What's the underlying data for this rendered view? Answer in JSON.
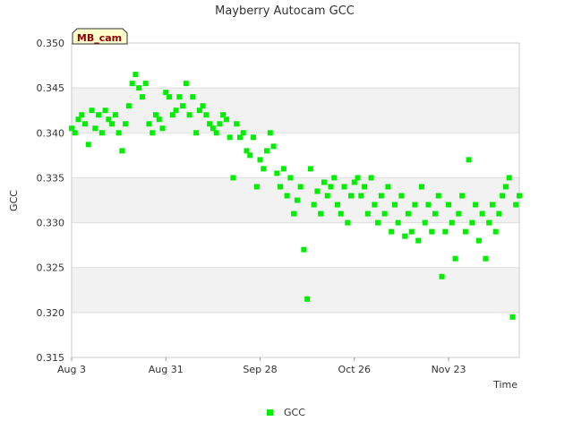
{
  "chart_data": {
    "type": "scatter",
    "title": "Mayberry Autocam GCC",
    "xlabel": "Time",
    "ylabel": "GCC",
    "badge": "MB_cam",
    "xlim": [
      "2024-08-03",
      "2024-12-14"
    ],
    "ylim": [
      0.315,
      0.35
    ],
    "x_ticks": [
      {
        "date": "2024-08-03",
        "label": "Aug 3"
      },
      {
        "date": "2024-08-31",
        "label": "Aug 31"
      },
      {
        "date": "2024-09-28",
        "label": "Sep 28"
      },
      {
        "date": "2024-10-26",
        "label": "Oct 26"
      },
      {
        "date": "2024-11-23",
        "label": "Nov 23"
      }
    ],
    "y_ticks": [
      "0.315",
      "0.320",
      "0.325",
      "0.330",
      "0.335",
      "0.340",
      "0.345",
      "0.350"
    ],
    "grid": true,
    "legend_position": "bottom",
    "marker_color": "#00ee00",
    "series": [
      {
        "name": "GCC",
        "points": [
          [
            "2024-08-03",
            0.3405
          ],
          [
            "2024-08-04",
            0.34
          ],
          [
            "2024-08-05",
            0.3415
          ],
          [
            "2024-08-06",
            0.342
          ],
          [
            "2024-08-07",
            0.341
          ],
          [
            "2024-08-08",
            0.3387
          ],
          [
            "2024-08-09",
            0.3425
          ],
          [
            "2024-08-10",
            0.3405
          ],
          [
            "2024-08-11",
            0.342
          ],
          [
            "2024-08-12",
            0.34
          ],
          [
            "2024-08-13",
            0.3425
          ],
          [
            "2024-08-14",
            0.3415
          ],
          [
            "2024-08-15",
            0.341
          ],
          [
            "2024-08-16",
            0.342
          ],
          [
            "2024-08-17",
            0.34
          ],
          [
            "2024-08-18",
            0.338
          ],
          [
            "2024-08-19",
            0.341
          ],
          [
            "2024-08-20",
            0.343
          ],
          [
            "2024-08-21",
            0.3455
          ],
          [
            "2024-08-22",
            0.3465
          ],
          [
            "2024-08-23",
            0.345
          ],
          [
            "2024-08-24",
            0.344
          ],
          [
            "2024-08-25",
            0.3455
          ],
          [
            "2024-08-26",
            0.341
          ],
          [
            "2024-08-27",
            0.34
          ],
          [
            "2024-08-28",
            0.342
          ],
          [
            "2024-08-29",
            0.3415
          ],
          [
            "2024-08-30",
            0.3405
          ],
          [
            "2024-08-31",
            0.3445
          ],
          [
            "2024-09-01",
            0.344
          ],
          [
            "2024-09-02",
            0.342
          ],
          [
            "2024-09-03",
            0.3425
          ],
          [
            "2024-09-04",
            0.344
          ],
          [
            "2024-09-05",
            0.343
          ],
          [
            "2024-09-06",
            0.3455
          ],
          [
            "2024-09-07",
            0.342
          ],
          [
            "2024-09-08",
            0.344
          ],
          [
            "2024-09-09",
            0.34
          ],
          [
            "2024-09-10",
            0.3425
          ],
          [
            "2024-09-11",
            0.343
          ],
          [
            "2024-09-12",
            0.342
          ],
          [
            "2024-09-13",
            0.341
          ],
          [
            "2024-09-14",
            0.3405
          ],
          [
            "2024-09-15",
            0.34
          ],
          [
            "2024-09-16",
            0.341
          ],
          [
            "2024-09-17",
            0.342
          ],
          [
            "2024-09-18",
            0.3415
          ],
          [
            "2024-09-19",
            0.3395
          ],
          [
            "2024-09-20",
            0.335
          ],
          [
            "2024-09-21",
            0.341
          ],
          [
            "2024-09-22",
            0.3395
          ],
          [
            "2024-09-23",
            0.34
          ],
          [
            "2024-09-24",
            0.338
          ],
          [
            "2024-09-25",
            0.3375
          ],
          [
            "2024-09-26",
            0.3395
          ],
          [
            "2024-09-27",
            0.334
          ],
          [
            "2024-09-28",
            0.337
          ],
          [
            "2024-09-29",
            0.336
          ],
          [
            "2024-09-30",
            0.338
          ],
          [
            "2024-10-01",
            0.34
          ],
          [
            "2024-10-02",
            0.3385
          ],
          [
            "2024-10-03",
            0.3355
          ],
          [
            "2024-10-04",
            0.334
          ],
          [
            "2024-10-05",
            0.336
          ],
          [
            "2024-10-06",
            0.333
          ],
          [
            "2024-10-07",
            0.335
          ],
          [
            "2024-10-08",
            0.331
          ],
          [
            "2024-10-09",
            0.3325
          ],
          [
            "2024-10-10",
            0.334
          ],
          [
            "2024-10-11",
            0.327
          ],
          [
            "2024-10-12",
            0.3215
          ],
          [
            "2024-10-13",
            0.336
          ],
          [
            "2024-10-14",
            0.332
          ],
          [
            "2024-10-15",
            0.3335
          ],
          [
            "2024-10-16",
            0.331
          ],
          [
            "2024-10-17",
            0.3345
          ],
          [
            "2024-10-18",
            0.333
          ],
          [
            "2024-10-19",
            0.334
          ],
          [
            "2024-10-20",
            0.335
          ],
          [
            "2024-10-21",
            0.332
          ],
          [
            "2024-10-22",
            0.331
          ],
          [
            "2024-10-23",
            0.334
          ],
          [
            "2024-10-24",
            0.33
          ],
          [
            "2024-10-25",
            0.333
          ],
          [
            "2024-10-26",
            0.3345
          ],
          [
            "2024-10-27",
            0.335
          ],
          [
            "2024-10-28",
            0.333
          ],
          [
            "2024-10-29",
            0.334
          ],
          [
            "2024-10-30",
            0.331
          ],
          [
            "2024-10-31",
            0.335
          ],
          [
            "2024-11-01",
            0.332
          ],
          [
            "2024-11-02",
            0.33
          ],
          [
            "2024-11-03",
            0.333
          ],
          [
            "2024-11-04",
            0.331
          ],
          [
            "2024-11-05",
            0.334
          ],
          [
            "2024-11-06",
            0.329
          ],
          [
            "2024-11-07",
            0.332
          ],
          [
            "2024-11-08",
            0.33
          ],
          [
            "2024-11-09",
            0.333
          ],
          [
            "2024-11-10",
            0.3285
          ],
          [
            "2024-11-11",
            0.331
          ],
          [
            "2024-11-12",
            0.329
          ],
          [
            "2024-11-13",
            0.332
          ],
          [
            "2024-11-14",
            0.328
          ],
          [
            "2024-11-15",
            0.334
          ],
          [
            "2024-11-16",
            0.33
          ],
          [
            "2024-11-17",
            0.332
          ],
          [
            "2024-11-18",
            0.329
          ],
          [
            "2024-11-19",
            0.331
          ],
          [
            "2024-11-20",
            0.333
          ],
          [
            "2024-11-21",
            0.324
          ],
          [
            "2024-11-22",
            0.329
          ],
          [
            "2024-11-23",
            0.332
          ],
          [
            "2024-11-24",
            0.33
          ],
          [
            "2024-11-25",
            0.326
          ],
          [
            "2024-11-26",
            0.331
          ],
          [
            "2024-11-27",
            0.333
          ],
          [
            "2024-11-28",
            0.329
          ],
          [
            "2024-11-29",
            0.337
          ],
          [
            "2024-11-30",
            0.33
          ],
          [
            "2024-12-01",
            0.332
          ],
          [
            "2024-12-02",
            0.328
          ],
          [
            "2024-12-03",
            0.331
          ],
          [
            "2024-12-04",
            0.326
          ],
          [
            "2024-12-05",
            0.33
          ],
          [
            "2024-12-06",
            0.332
          ],
          [
            "2024-12-07",
            0.329
          ],
          [
            "2024-12-08",
            0.331
          ],
          [
            "2024-12-09",
            0.333
          ],
          [
            "2024-12-10",
            0.334
          ],
          [
            "2024-12-11",
            0.335
          ],
          [
            "2024-12-12",
            0.3195
          ],
          [
            "2024-12-13",
            0.332
          ],
          [
            "2024-12-14",
            0.333
          ]
        ]
      }
    ]
  }
}
